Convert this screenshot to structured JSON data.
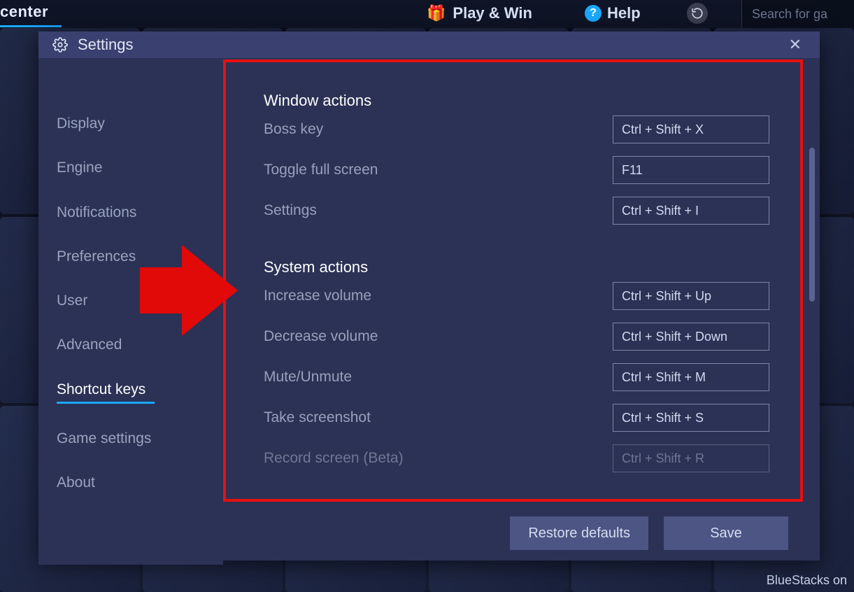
{
  "background": {
    "center_label": "center",
    "play_win": "Play & Win",
    "help": "Help",
    "search_placeholder": "Search for ga",
    "bottom_text": "BlueStacks on"
  },
  "modal": {
    "title": "Settings",
    "close_glyph": "✕"
  },
  "sidebar": {
    "items": [
      {
        "label": "Display"
      },
      {
        "label": "Engine"
      },
      {
        "label": "Notifications"
      },
      {
        "label": "Preferences"
      },
      {
        "label": "User"
      },
      {
        "label": "Advanced"
      },
      {
        "label": "Shortcut keys"
      },
      {
        "label": "Game settings"
      },
      {
        "label": "About"
      }
    ],
    "active_index": 6
  },
  "sections": [
    {
      "title": "Window actions",
      "rows": [
        {
          "label": "Boss key",
          "shortcut": "Ctrl + Shift + X"
        },
        {
          "label": "Toggle full screen",
          "shortcut": "F11"
        },
        {
          "label": "Settings",
          "shortcut": "Ctrl + Shift + I"
        }
      ]
    },
    {
      "title": "System actions",
      "rows": [
        {
          "label": "Increase volume",
          "shortcut": "Ctrl + Shift + Up"
        },
        {
          "label": "Decrease volume",
          "shortcut": "Ctrl + Shift + Down"
        },
        {
          "label": "Mute/Unmute",
          "shortcut": "Ctrl + Shift + M"
        },
        {
          "label": "Take screenshot",
          "shortcut": "Ctrl + Shift + S"
        },
        {
          "label": "Record screen (Beta)",
          "shortcut": "Ctrl + Shift + R",
          "dim": true
        }
      ]
    }
  ],
  "footer": {
    "restore": "Restore defaults",
    "save": "Save"
  }
}
